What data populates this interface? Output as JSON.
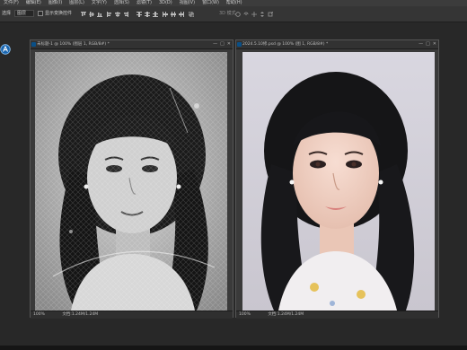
{
  "menu": [
    "文件(F)",
    "编辑(E)",
    "图像(I)",
    "图层(L)",
    "文字(Y)",
    "选择(S)",
    "滤镜(T)",
    "3D(D)",
    "视图(V)",
    "窗口(W)",
    "帮助(H)"
  ],
  "options": {
    "tool_label": "选择",
    "layer_combo": "图层",
    "show_transform_label": "显示变换控件",
    "mode_3d_label": "3D 模式"
  },
  "doc_left": {
    "title": "未标题-1 @ 100% (图层 1, RGB/8#) *",
    "zoom": "100%",
    "doc_info": "文档:1.24M/1.24M"
  },
  "doc_right": {
    "title": "2024.5.10修.psd @ 100% (图 1, RGB/8#) *",
    "zoom": "100%",
    "doc_info": "文档:1.24M/1.24M"
  },
  "icons": {
    "app": "photoshop-tool-icon",
    "close": "close-icon",
    "minimize": "minimize-icon",
    "maximize": "maximize-icon"
  },
  "colors": {
    "workspace": "#282828",
    "menubar": "#3c3c3c",
    "accent": "#0a4f86"
  }
}
